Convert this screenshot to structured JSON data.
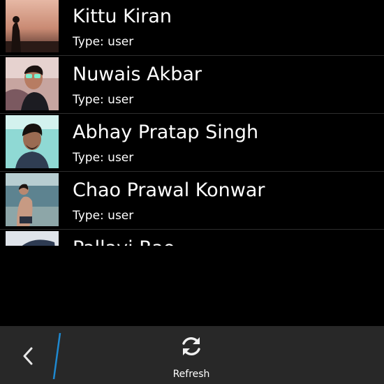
{
  "contacts": [
    {
      "name": "Kittu Kiran",
      "type": "Type: user"
    },
    {
      "name": "Nuwais Akbar",
      "type": "Type: user"
    },
    {
      "name": "Abhay Pratap Singh",
      "type": "Type: user"
    },
    {
      "name": "Chao Prawal Konwar",
      "type": "Type: user"
    },
    {
      "name": "Pallavi Rao",
      "type": ""
    }
  ],
  "toolbar": {
    "refresh_label": "Refresh"
  },
  "colors": {
    "accent": "#1e88d0",
    "toolbar_bg": "#282828",
    "background": "#000000"
  },
  "icons": {
    "back": "chevron-left-icon",
    "refresh": "refresh-icon"
  }
}
